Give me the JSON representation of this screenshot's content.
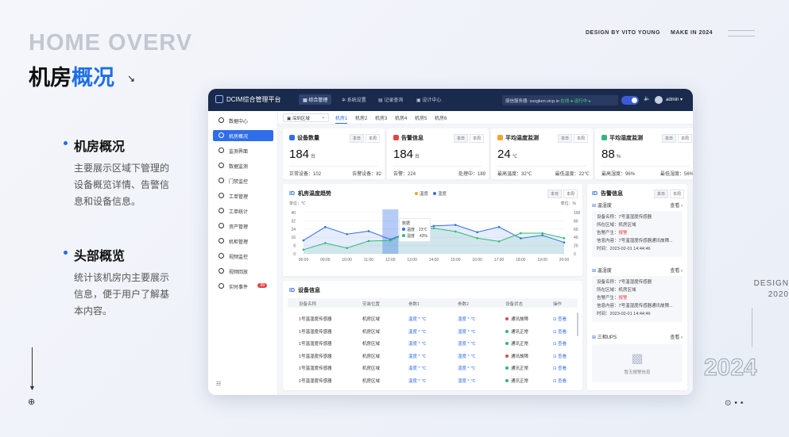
{
  "hero": {
    "title_en": "HOME OVERVIE",
    "title_cn_a": "机房",
    "title_cn_b": "概况",
    "arrow": "↘",
    "credit_design": "DESIGN BY VITO YOUNG",
    "credit_make": "MAKE IN 2024",
    "side_design": "DESIGN",
    "side_year_small": "2020",
    "year_outline": "2024"
  },
  "sections": [
    {
      "title": "机房概况",
      "desc": "主要展示区域下管理的设备概览详情、告警信息和设备信息。"
    },
    {
      "title": "头部概览",
      "desc": "统计该机房内主要展示信息，便于用户了解基本内容。"
    }
  ],
  "app": {
    "title": "DCIM综合管理平台",
    "nav": [
      "综合管理",
      "系统设置",
      "记录查询",
      "设计中心"
    ],
    "server_label": "授信服务器:",
    "server_host": "sszgken.vicp.io",
    "server_status_on": "在线",
    "server_status_run": "● 运行中 ▸",
    "user": "admin",
    "user_caret": "▾",
    "volume_icon": "🔈"
  },
  "sidebar": {
    "items": [
      {
        "label": "数据中心",
        "active": false
      },
      {
        "label": "机房概况",
        "active": true
      },
      {
        "label": "监测界面",
        "active": false
      },
      {
        "label": "数据监测",
        "active": false
      },
      {
        "label": "门禁监控",
        "active": false
      },
      {
        "label": "工单管理",
        "active": false
      },
      {
        "label": "工单统计",
        "active": false
      },
      {
        "label": "资产管理",
        "active": false
      },
      {
        "label": "机柜管理",
        "active": false
      },
      {
        "label": "视频监控",
        "active": false
      },
      {
        "label": "视频回放",
        "active": false
      },
      {
        "label": "实时事件",
        "active": false,
        "badge": "99"
      }
    ],
    "footer_icon": "☷"
  },
  "region": {
    "value": "深圳区域",
    "caret": "⌄"
  },
  "room_tabs": [
    "机房1",
    "机房2",
    "机房3",
    "机房4",
    "机房5",
    "机房6"
  ],
  "kpis": [
    {
      "title": "设备数量",
      "value": "184",
      "unit": "台",
      "tab_a": "本日",
      "tab_b": "本周",
      "left_label": "正常设备：",
      "left_val": "102",
      "right_label": "告警设备：",
      "right_val": "82",
      "color": "#2f6ee8"
    },
    {
      "title": "告警信息",
      "value": "184",
      "unit": "台",
      "tab_a": "本日",
      "tab_b": "本周",
      "left_label": "告警：",
      "left_val": "224",
      "right_label": "处理中：",
      "right_val": "189",
      "color": "#e54545"
    },
    {
      "title": "平均温度监测",
      "value": "24",
      "unit": "℃",
      "tab_a": "本日",
      "tab_b": "本周",
      "left_label": "最高温度：",
      "left_val": "32℃",
      "right_label": "最低温度：",
      "right_val": "22℃",
      "color": "#f0a52c"
    },
    {
      "title": "平均湿度监测",
      "value": "88",
      "unit": "%",
      "tab_a": "本日",
      "tab_b": "本周",
      "left_label": "最高湿度：",
      "left_val": "96%",
      "right_label": "最低湿度：",
      "right_val": "56%",
      "color": "#2fb87a"
    }
  ],
  "trend": {
    "title": "机房温度趋势",
    "legend_temp": "温度",
    "legend_hum": "湿度",
    "tab_a": "本日",
    "tab_b": "本周",
    "left_unit": "单位：℃",
    "right_unit": "单位：%",
    "tooltip": {
      "title": "数据",
      "temp_label": "温度",
      "temp_val": "23℃",
      "hum_label": "湿度",
      "hum_val": "43%"
    }
  },
  "chart_data": {
    "type": "line",
    "categories": [
      "06:00",
      "09:00",
      "10:00",
      "11:00",
      "12:00",
      "13:00",
      "14:00",
      "15:00",
      "16:00",
      "17:00",
      "18:00",
      "19:00",
      "20:00"
    ],
    "series": [
      {
        "name": "温度",
        "axis": "left",
        "values": [
          13,
          26,
          19,
          22,
          14,
          22,
          27,
          28,
          21,
          26,
          15,
          18,
          11
        ],
        "color": "#2f6ee8"
      },
      {
        "name": "湿度",
        "axis": "right",
        "values": [
          10,
          26,
          14,
          31,
          32,
          56,
          62,
          54,
          38,
          30,
          50,
          50,
          38
        ],
        "color": "#2fb87a"
      }
    ],
    "left_ticks": [
      "40",
      "32",
      "24",
      "16",
      "8",
      "0"
    ],
    "right_ticks": [
      "100",
      "80",
      "60",
      "40",
      "20",
      "0"
    ],
    "ylim_left": [
      0,
      40
    ],
    "ylim_right": [
      0,
      100
    ],
    "highlight_category": "12:00"
  },
  "devices": {
    "title": "设备信息",
    "headers": [
      "设备名称",
      "安装位置",
      "参数1",
      "参数2",
      "设备状态",
      "操作"
    ],
    "rows": [
      {
        "name": "1号温湿度传感器",
        "loc": "机房区域",
        "p1": "温度 * ℃",
        "p2": "湿度 * ℃",
        "status": "通讯故障",
        "ok": false,
        "op": "查看"
      },
      {
        "name": "1号温湿度传感器",
        "loc": "机房区域",
        "p1": "温度 * ℃",
        "p2": "湿度 * ℃",
        "status": "通讯正常",
        "ok": true,
        "op": "查看"
      },
      {
        "name": "1号温湿度传感器",
        "loc": "机房区域",
        "p1": "温度 * ℃",
        "p2": "湿度 * ℃",
        "status": "通讯正常",
        "ok": true,
        "op": "查看"
      },
      {
        "name": "1号温湿度传感器",
        "loc": "机房区域",
        "p1": "温度 * ℃",
        "p2": "湿度 * ℃",
        "status": "通讯故障",
        "ok": false,
        "op": "查看"
      },
      {
        "name": "1号温湿度传感器",
        "loc": "机房区域",
        "p1": "温度 * ℃",
        "p2": "湿度 * ℃",
        "status": "通讯正常",
        "ok": true,
        "op": "查看"
      },
      {
        "name": "1号温湿度传感器",
        "loc": "机房区域",
        "p1": "温度 * ℃",
        "p2": "湿度 * ℃",
        "status": "通讯正常",
        "ok": true,
        "op": "查看"
      }
    ]
  },
  "alarms": {
    "title": "告警信息",
    "tab_a": "本日",
    "tab_b": "本周",
    "more": "查看 ›",
    "groups": [
      {
        "name": "温湿度",
        "lines": [
          [
            "设备名称：",
            "7号温湿度传感器"
          ],
          [
            "所在区域：",
            "机房区域"
          ],
          [
            "告警产生：",
            "报警"
          ],
          [
            "信息内容：",
            "7号温湿度传感器通讯故障..."
          ],
          [
            "时间：",
            "2023-02-01 14:44:46"
          ]
        ]
      },
      {
        "name": "温湿度",
        "lines": [
          [
            "设备名称：",
            "7号温湿度传感器"
          ],
          [
            "所在区域：",
            "机房区域"
          ],
          [
            "告警产生：",
            "报警"
          ],
          [
            "信息内容：",
            "7号温湿度传感器通讯故障..."
          ],
          [
            "时间：",
            "2023-02-01 14:44:46"
          ]
        ]
      },
      {
        "name": "三相UPS",
        "empty": "暂无报警信息"
      }
    ]
  }
}
